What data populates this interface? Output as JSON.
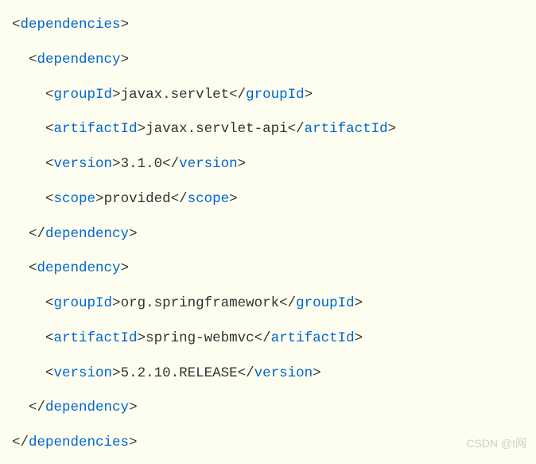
{
  "lines": [
    {
      "indent": 0,
      "parts": [
        {
          "type": "bracket",
          "text": "<"
        },
        {
          "type": "tag",
          "text": "dependencies"
        },
        {
          "type": "bracket",
          "text": ">"
        }
      ]
    },
    {
      "indent": 1,
      "parts": [
        {
          "type": "bracket",
          "text": "<"
        },
        {
          "type": "tag",
          "text": "dependency"
        },
        {
          "type": "bracket",
          "text": ">"
        }
      ]
    },
    {
      "indent": 2,
      "parts": [
        {
          "type": "bracket",
          "text": "<"
        },
        {
          "type": "tag",
          "text": "groupId"
        },
        {
          "type": "bracket",
          "text": ">"
        },
        {
          "type": "text",
          "text": "javax.servlet"
        },
        {
          "type": "bracket",
          "text": "</"
        },
        {
          "type": "tag",
          "text": "groupId"
        },
        {
          "type": "bracket",
          "text": ">"
        }
      ]
    },
    {
      "indent": 2,
      "parts": [
        {
          "type": "bracket",
          "text": "<"
        },
        {
          "type": "tag",
          "text": "artifactId"
        },
        {
          "type": "bracket",
          "text": ">"
        },
        {
          "type": "text",
          "text": "javax.servlet-api"
        },
        {
          "type": "bracket",
          "text": "</"
        },
        {
          "type": "tag",
          "text": "artifactId"
        },
        {
          "type": "bracket",
          "text": ">"
        }
      ]
    },
    {
      "indent": 2,
      "parts": [
        {
          "type": "bracket",
          "text": "<"
        },
        {
          "type": "tag",
          "text": "version"
        },
        {
          "type": "bracket",
          "text": ">"
        },
        {
          "type": "text",
          "text": "3.1.0"
        },
        {
          "type": "bracket",
          "text": "</"
        },
        {
          "type": "tag",
          "text": "version"
        },
        {
          "type": "bracket",
          "text": ">"
        }
      ]
    },
    {
      "indent": 2,
      "parts": [
        {
          "type": "bracket",
          "text": "<"
        },
        {
          "type": "tag",
          "text": "scope"
        },
        {
          "type": "bracket",
          "text": ">"
        },
        {
          "type": "text",
          "text": "provided"
        },
        {
          "type": "bracket",
          "text": "</"
        },
        {
          "type": "tag",
          "text": "scope"
        },
        {
          "type": "bracket",
          "text": ">"
        }
      ]
    },
    {
      "indent": 1,
      "parts": [
        {
          "type": "bracket",
          "text": "</"
        },
        {
          "type": "tag",
          "text": "dependency"
        },
        {
          "type": "bracket",
          "text": ">"
        }
      ]
    },
    {
      "indent": 1,
      "parts": [
        {
          "type": "bracket",
          "text": "<"
        },
        {
          "type": "tag",
          "text": "dependency"
        },
        {
          "type": "bracket",
          "text": ">"
        }
      ]
    },
    {
      "indent": 2,
      "parts": [
        {
          "type": "bracket",
          "text": "<"
        },
        {
          "type": "tag",
          "text": "groupId"
        },
        {
          "type": "bracket",
          "text": ">"
        },
        {
          "type": "text",
          "text": "org.springframework"
        },
        {
          "type": "bracket",
          "text": "</"
        },
        {
          "type": "tag",
          "text": "groupId"
        },
        {
          "type": "bracket",
          "text": ">"
        }
      ]
    },
    {
      "indent": 2,
      "parts": [
        {
          "type": "bracket",
          "text": "<"
        },
        {
          "type": "tag",
          "text": "artifactId"
        },
        {
          "type": "bracket",
          "text": ">"
        },
        {
          "type": "text",
          "text": "spring-webmvc"
        },
        {
          "type": "bracket",
          "text": "</"
        },
        {
          "type": "tag",
          "text": "artifactId"
        },
        {
          "type": "bracket",
          "text": ">"
        }
      ]
    },
    {
      "indent": 2,
      "parts": [
        {
          "type": "bracket",
          "text": "<"
        },
        {
          "type": "tag",
          "text": "version"
        },
        {
          "type": "bracket",
          "text": ">"
        },
        {
          "type": "text",
          "text": "5.2.10.RELEASE"
        },
        {
          "type": "bracket",
          "text": "</"
        },
        {
          "type": "tag",
          "text": "version"
        },
        {
          "type": "bracket",
          "text": ">"
        }
      ]
    },
    {
      "indent": 1,
      "parts": [
        {
          "type": "bracket",
          "text": "</"
        },
        {
          "type": "tag",
          "text": "dependency"
        },
        {
          "type": "bracket",
          "text": ">"
        }
      ]
    },
    {
      "indent": 0,
      "parts": [
        {
          "type": "bracket",
          "text": "</"
        },
        {
          "type": "tag",
          "text": "dependencies"
        },
        {
          "type": "bracket",
          "text": ">"
        }
      ]
    }
  ],
  "watermark": "CSDN @t网"
}
